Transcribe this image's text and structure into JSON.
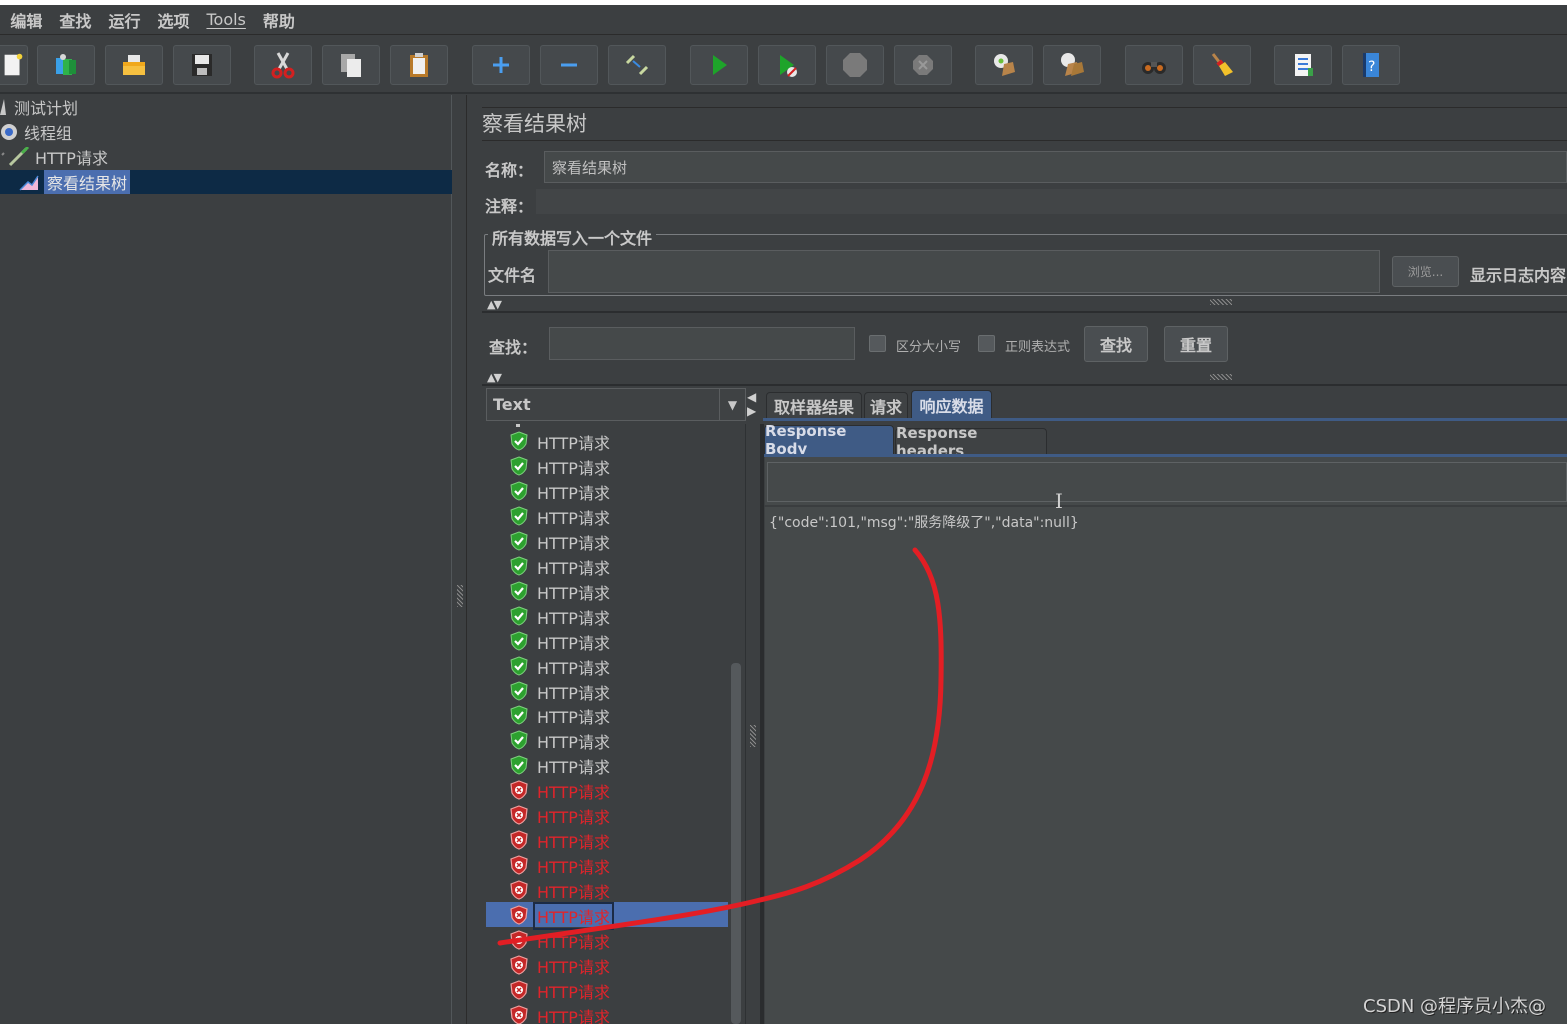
{
  "menubar": {
    "items": [
      "编辑",
      "查找",
      "运行",
      "选项",
      "Tools",
      "帮助"
    ]
  },
  "toolbar": {
    "buttons": [
      {
        "name": "new",
        "icon": "new-file-icon"
      },
      {
        "name": "templates",
        "icon": "templates-icon"
      },
      {
        "name": "open",
        "icon": "open-folder-icon"
      },
      {
        "name": "save",
        "icon": "save-disk-icon"
      },
      {
        "name": "cut",
        "icon": "scissors-icon"
      },
      {
        "name": "copy",
        "icon": "copy-icon"
      },
      {
        "name": "paste",
        "icon": "paste-clipboard-icon"
      },
      {
        "name": "expand",
        "icon": "plus-icon"
      },
      {
        "name": "collapse",
        "icon": "minus-icon"
      },
      {
        "name": "toggle",
        "icon": "toggle-icon"
      },
      {
        "name": "start",
        "icon": "play-icon"
      },
      {
        "name": "start-no-pauses",
        "icon": "play-no-timers-icon"
      },
      {
        "name": "stop",
        "icon": "stop-icon"
      },
      {
        "name": "shutdown",
        "icon": "shutdown-icon"
      },
      {
        "name": "clear",
        "icon": "clear-broom-icon"
      },
      {
        "name": "clear-all",
        "icon": "clear-all-broom-icon"
      },
      {
        "name": "search",
        "icon": "binoculars-icon"
      },
      {
        "name": "reset-search",
        "icon": "broom-icon"
      },
      {
        "name": "function-helper",
        "icon": "list-icon"
      },
      {
        "name": "help",
        "icon": "help-book-icon"
      }
    ]
  },
  "tree": {
    "items": [
      {
        "label": "测试计划",
        "icon": "test-plan-icon"
      },
      {
        "label": "线程组",
        "icon": "gear-icon"
      },
      {
        "label": "HTTP请求",
        "icon": "pipette-icon"
      },
      {
        "label": "察看结果树",
        "icon": "chart-icon",
        "selected": true
      }
    ]
  },
  "panel": {
    "title": "察看结果树",
    "name_label": "名称：",
    "name_value": "察看结果树",
    "comment_label": "注释：",
    "comment_value": "",
    "file_group_label": "所有数据写入一个文件",
    "filename_label": "文件名",
    "filename_value": "",
    "browse_button": "浏览...",
    "log_label": "显示日志内容",
    "search_label": "查找：",
    "search_value": "",
    "case_sensitive_label": "区分大小写",
    "regex_label": "正则表达式",
    "find_button": "查找",
    "reset_button": "重置",
    "renderer_selected": "Text"
  },
  "results": {
    "items": [
      {
        "label": "HTTP请求",
        "status": "ok"
      },
      {
        "label": "HTTP请求",
        "status": "ok"
      },
      {
        "label": "HTTP请求",
        "status": "ok"
      },
      {
        "label": "HTTP请求",
        "status": "ok"
      },
      {
        "label": "HTTP请求",
        "status": "ok"
      },
      {
        "label": "HTTP请求",
        "status": "ok"
      },
      {
        "label": "HTTP请求",
        "status": "ok"
      },
      {
        "label": "HTTP请求",
        "status": "ok"
      },
      {
        "label": "HTTP请求",
        "status": "ok"
      },
      {
        "label": "HTTP请求",
        "status": "ok"
      },
      {
        "label": "HTTP请求",
        "status": "ok"
      },
      {
        "label": "HTTP请求",
        "status": "ok"
      },
      {
        "label": "HTTP请求",
        "status": "ok"
      },
      {
        "label": "HTTP请求",
        "status": "ok"
      },
      {
        "label": "HTTP请求",
        "status": "fail"
      },
      {
        "label": "HTTP请求",
        "status": "fail"
      },
      {
        "label": "HTTP请求",
        "status": "fail"
      },
      {
        "label": "HTTP请求",
        "status": "fail"
      },
      {
        "label": "HTTP请求",
        "status": "fail"
      },
      {
        "label": "HTTP请求",
        "status": "fail",
        "selected": true
      },
      {
        "label": "HTTP请求",
        "status": "fail"
      },
      {
        "label": "HTTP请求",
        "status": "fail"
      },
      {
        "label": "HTTP请求",
        "status": "fail"
      },
      {
        "label": "HTTP请求",
        "status": "fail"
      }
    ]
  },
  "tabs": {
    "main": [
      {
        "label": "取样器结果",
        "active": false
      },
      {
        "label": "请求",
        "active": false
      },
      {
        "label": "响应数据",
        "active": true
      }
    ],
    "sub": [
      {
        "label": "Response Body",
        "active": true
      },
      {
        "label": "Response headers",
        "active": false
      }
    ]
  },
  "response": {
    "body": "{\"code\":101,\"msg\":\"服务降级了\",\"data\":null}"
  },
  "colors": {
    "accent": "#4b6eaf",
    "error_text": "#e0242b",
    "annotation": "#e31e24"
  },
  "watermark": "CSDN @程序员小杰@"
}
